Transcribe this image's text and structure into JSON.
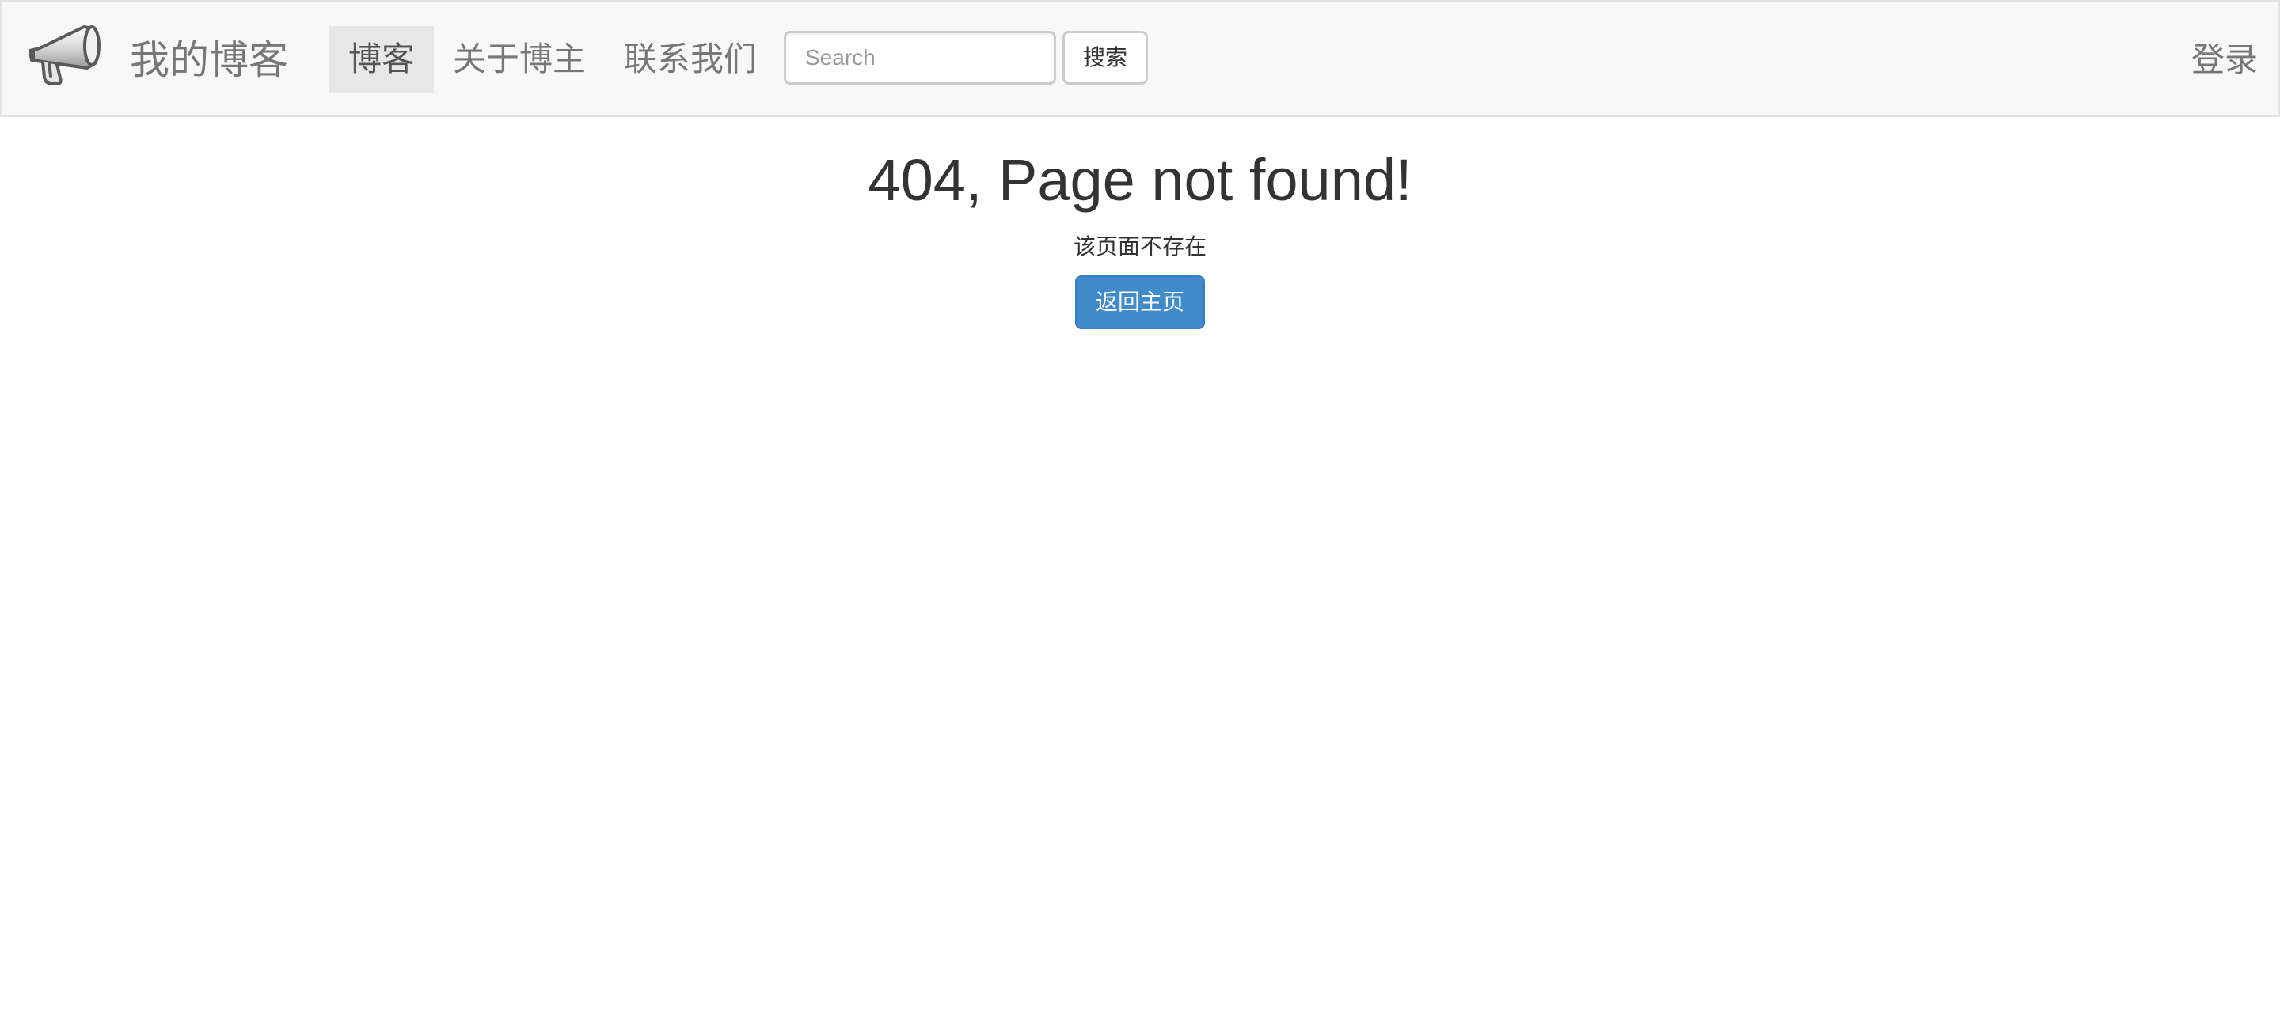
{
  "navbar": {
    "brand_icon": "megaphone-icon",
    "brand_title": "我的博客",
    "nav_items": [
      {
        "label": "博客",
        "active": true
      },
      {
        "label": "关于博主",
        "active": false
      },
      {
        "label": "联系我们",
        "active": false
      }
    ],
    "search": {
      "placeholder": "Search",
      "value": "",
      "button_label": "搜索"
    },
    "login_label": "登录"
  },
  "main": {
    "title": "404, Page not found!",
    "message": "该页面不存在",
    "home_button_label": "返回主页"
  },
  "colors": {
    "navbar_bg": "#f8f8f8",
    "active_nav_bg": "#e7e7e7",
    "primary_button": "#428bca"
  }
}
